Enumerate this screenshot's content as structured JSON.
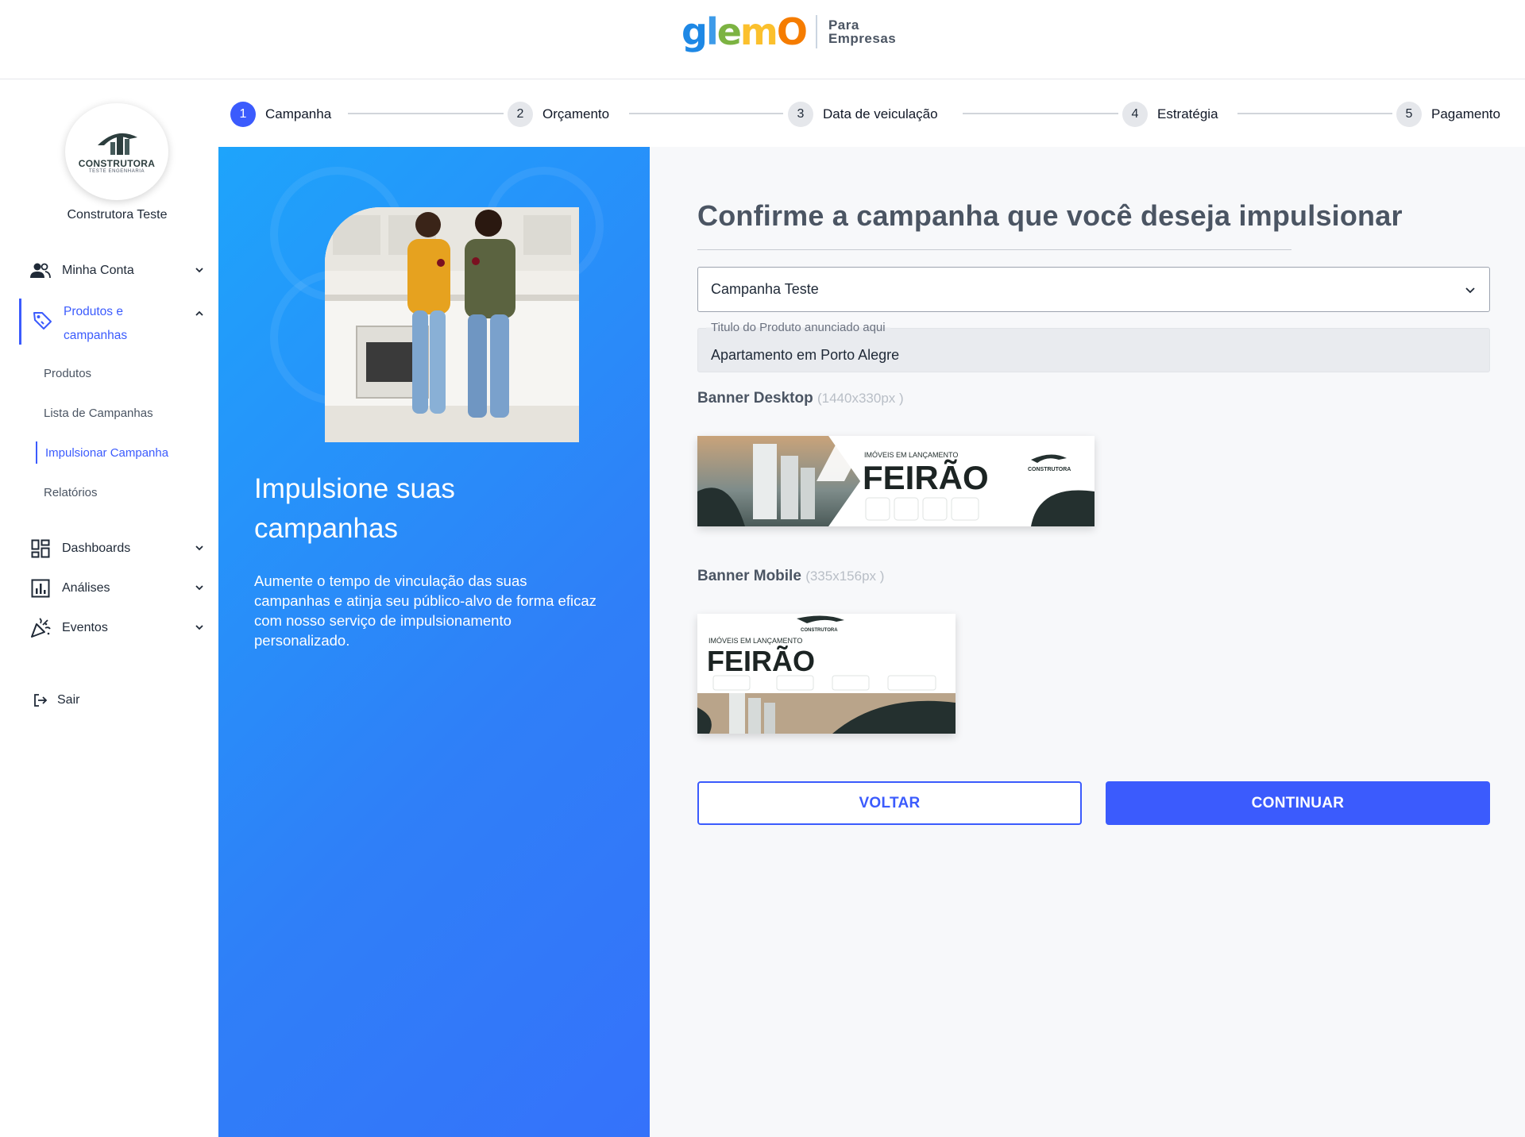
{
  "header": {
    "brand": {
      "g": "g",
      "l": "l",
      "e": "e",
      "m": "m",
      "o": "O"
    },
    "brand_sub_line1": "Para",
    "brand_sub_line2": "Empresas"
  },
  "sidebar": {
    "logo_text": "CONSTRUTORA",
    "logo_sub": "TESTE ENGENHARIA",
    "company_name": "Construtora Teste",
    "nav": {
      "minha_conta": "Minha Conta",
      "produtos_campanhas": "Produtos e campanhas",
      "dashboards": "Dashboards",
      "analises": "Análises",
      "eventos": "Eventos",
      "sair": "Sair"
    },
    "sub_items": {
      "produtos": "Produtos",
      "lista_campanhas": "Lista de Campanhas",
      "impulsionar": "Impulsionar Campanha",
      "relatorios": "Relatórios"
    }
  },
  "stepper": {
    "steps": [
      {
        "num": "1",
        "label": "Campanha"
      },
      {
        "num": "2",
        "label": "Orçamento"
      },
      {
        "num": "3",
        "label": "Data de veiculação"
      },
      {
        "num": "4",
        "label": "Estratégia"
      },
      {
        "num": "5",
        "label": "Pagamento"
      }
    ]
  },
  "promo": {
    "title": "Impulsione suas campanhas",
    "text": "Aumente o tempo de vinculação das suas campanhas e atinja seu público-alvo de forma eficaz com nosso serviço de impulsionamento personalizado."
  },
  "main": {
    "title": "Confirme a campanha que você deseja impulsionar",
    "campaign_select": "Campanha Teste",
    "product_title_label": "Titulo do Produto anunciado aqui",
    "product_title_value": "Apartamento em Porto Alegre",
    "banner_desktop_label": "Banner Desktop",
    "banner_desktop_dims": "(1440x330px )",
    "banner_mobile_label": "Banner Mobile",
    "banner_mobile_dims": "(335x156px )",
    "banner_kicker": "IMÓVEIS EM LANÇAMENTO",
    "banner_headline": "FEIRÃO",
    "banner_brand": "CONSTRUTORA",
    "back_button": "VOLTAR",
    "continue_button": "CONTINUAR"
  },
  "colors": {
    "accent": "#3b5bfd",
    "promo_start": "#1ea4fb",
    "promo_end": "#3572fa"
  }
}
